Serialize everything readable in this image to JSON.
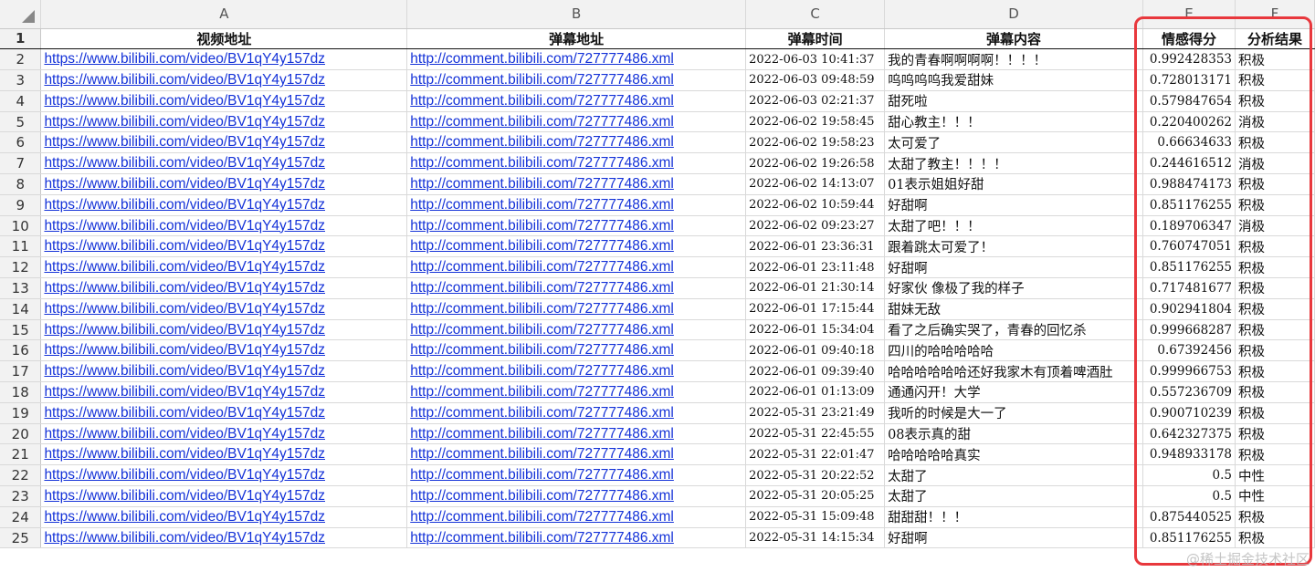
{
  "column_letters": [
    "A",
    "B",
    "C",
    "D",
    "E",
    "F"
  ],
  "headers": [
    "视频地址",
    "弹幕地址",
    "弹幕时间",
    "弹幕内容",
    "情感得分",
    "分析结果"
  ],
  "rows": [
    {
      "num": "2",
      "video": "https://www.bilibili.com/video/BV1qY4y157dz",
      "danmaku": "http://comment.bilibili.com/727777486.xml",
      "time": "2022-06-03 10:41:37",
      "content": "我的青春啊啊啊啊！！！！",
      "score": "0.992428353",
      "result": "积极"
    },
    {
      "num": "3",
      "video": "https://www.bilibili.com/video/BV1qY4y157dz",
      "danmaku": "http://comment.bilibili.com/727777486.xml",
      "time": "2022-06-03 09:48:59",
      "content": "呜呜呜呜我爱甜妹",
      "score": "0.728013171",
      "result": "积极"
    },
    {
      "num": "4",
      "video": "https://www.bilibili.com/video/BV1qY4y157dz",
      "danmaku": "http://comment.bilibili.com/727777486.xml",
      "time": "2022-06-03 02:21:37",
      "content": "甜死啦",
      "score": "0.579847654",
      "result": "积极"
    },
    {
      "num": "5",
      "video": "https://www.bilibili.com/video/BV1qY4y157dz",
      "danmaku": "http://comment.bilibili.com/727777486.xml",
      "time": "2022-06-02 19:58:45",
      "content": "甜心教主！！！",
      "score": "0.220400262",
      "result": "消极"
    },
    {
      "num": "6",
      "video": "https://www.bilibili.com/video/BV1qY4y157dz",
      "danmaku": "http://comment.bilibili.com/727777486.xml",
      "time": "2022-06-02 19:58:23",
      "content": "太可爱了",
      "score": "0.66634633",
      "result": "积极"
    },
    {
      "num": "7",
      "video": "https://www.bilibili.com/video/BV1qY4y157dz",
      "danmaku": "http://comment.bilibili.com/727777486.xml",
      "time": "2022-06-02 19:26:58",
      "content": "太甜了教主！！！！",
      "score": "0.244616512",
      "result": "消极"
    },
    {
      "num": "8",
      "video": "https://www.bilibili.com/video/BV1qY4y157dz",
      "danmaku": "http://comment.bilibili.com/727777486.xml",
      "time": "2022-06-02 14:13:07",
      "content": "01表示姐姐好甜",
      "score": "0.988474173",
      "result": "积极"
    },
    {
      "num": "9",
      "video": "https://www.bilibili.com/video/BV1qY4y157dz",
      "danmaku": "http://comment.bilibili.com/727777486.xml",
      "time": "2022-06-02 10:59:44",
      "content": "好甜啊",
      "score": "0.851176255",
      "result": "积极"
    },
    {
      "num": "10",
      "video": "https://www.bilibili.com/video/BV1qY4y157dz",
      "danmaku": "http://comment.bilibili.com/727777486.xml",
      "time": "2022-06-02 09:23:27",
      "content": "太甜了吧！！！",
      "score": "0.189706347",
      "result": "消极"
    },
    {
      "num": "11",
      "video": "https://www.bilibili.com/video/BV1qY4y157dz",
      "danmaku": "http://comment.bilibili.com/727777486.xml",
      "time": "2022-06-01 23:36:31",
      "content": "跟着跳太可爱了！",
      "score": "0.760747051",
      "result": "积极"
    },
    {
      "num": "12",
      "video": "https://www.bilibili.com/video/BV1qY4y157dz",
      "danmaku": "http://comment.bilibili.com/727777486.xml",
      "time": "2022-06-01 23:11:48",
      "content": "好甜啊",
      "score": "0.851176255",
      "result": "积极"
    },
    {
      "num": "13",
      "video": "https://www.bilibili.com/video/BV1qY4y157dz",
      "danmaku": "http://comment.bilibili.com/727777486.xml",
      "time": "2022-06-01 21:30:14",
      "content": "好家伙 像极了我的样子",
      "score": "0.717481677",
      "result": "积极"
    },
    {
      "num": "14",
      "video": "https://www.bilibili.com/video/BV1qY4y157dz",
      "danmaku": "http://comment.bilibili.com/727777486.xml",
      "time": "2022-06-01 17:15:44",
      "content": "甜妹无敌",
      "score": "0.902941804",
      "result": "积极"
    },
    {
      "num": "15",
      "video": "https://www.bilibili.com/video/BV1qY4y157dz",
      "danmaku": "http://comment.bilibili.com/727777486.xml",
      "time": "2022-06-01 15:34:04",
      "content": "看了之后确实哭了，青春的回忆杀",
      "score": "0.999668287",
      "result": "积极"
    },
    {
      "num": "16",
      "video": "https://www.bilibili.com/video/BV1qY4y157dz",
      "danmaku": "http://comment.bilibili.com/727777486.xml",
      "time": "2022-06-01 09:40:18",
      "content": "四川的哈哈哈哈哈",
      "score": "0.67392456",
      "result": "积极"
    },
    {
      "num": "17",
      "video": "https://www.bilibili.com/video/BV1qY4y157dz",
      "danmaku": "http://comment.bilibili.com/727777486.xml",
      "time": "2022-06-01 09:39:40",
      "content": "哈哈哈哈哈哈还好我家木有顶着啤酒肚",
      "score": "0.999966753",
      "result": "积极"
    },
    {
      "num": "18",
      "video": "https://www.bilibili.com/video/BV1qY4y157dz",
      "danmaku": "http://comment.bilibili.com/727777486.xml",
      "time": "2022-06-01 01:13:09",
      "content": "通通闪开！大学",
      "score": "0.557236709",
      "result": "积极"
    },
    {
      "num": "19",
      "video": "https://www.bilibili.com/video/BV1qY4y157dz",
      "danmaku": "http://comment.bilibili.com/727777486.xml",
      "time": "2022-05-31 23:21:49",
      "content": "我听的时候是大一了",
      "score": "0.900710239",
      "result": "积极"
    },
    {
      "num": "20",
      "video": "https://www.bilibili.com/video/BV1qY4y157dz",
      "danmaku": "http://comment.bilibili.com/727777486.xml",
      "time": "2022-05-31 22:45:55",
      "content": "08表示真的甜",
      "score": "0.642327375",
      "result": "积极"
    },
    {
      "num": "21",
      "video": "https://www.bilibili.com/video/BV1qY4y157dz",
      "danmaku": "http://comment.bilibili.com/727777486.xml",
      "time": "2022-05-31 22:01:47",
      "content": "哈哈哈哈哈真实",
      "score": "0.948933178",
      "result": "积极"
    },
    {
      "num": "22",
      "video": "https://www.bilibili.com/video/BV1qY4y157dz",
      "danmaku": "http://comment.bilibili.com/727777486.xml",
      "time": "2022-05-31 20:22:52",
      "content": "太甜了",
      "score": "0.5",
      "result": "中性"
    },
    {
      "num": "23",
      "video": "https://www.bilibili.com/video/BV1qY4y157dz",
      "danmaku": "http://comment.bilibili.com/727777486.xml",
      "time": "2022-05-31 20:05:25",
      "content": "太甜了",
      "score": "0.5",
      "result": "中性"
    },
    {
      "num": "24",
      "video": "https://www.bilibili.com/video/BV1qY4y157dz",
      "danmaku": "http://comment.bilibili.com/727777486.xml",
      "time": "2022-05-31 15:09:48",
      "content": "甜甜甜！！！",
      "score": "0.875440525",
      "result": "积极"
    },
    {
      "num": "25",
      "video": "https://www.bilibili.com/video/BV1qY4y157dz",
      "danmaku": "http://comment.bilibili.com/727777486.xml",
      "time": "2022-05-31 14:15:34",
      "content": "好甜啊",
      "score": "0.851176255",
      "result": "积极"
    }
  ],
  "watermark": "@稀土掘金技术社区",
  "colors": {
    "link": "#1432d8",
    "highlight_border": "#e8383d",
    "header_bg": "#f2f2f2"
  }
}
